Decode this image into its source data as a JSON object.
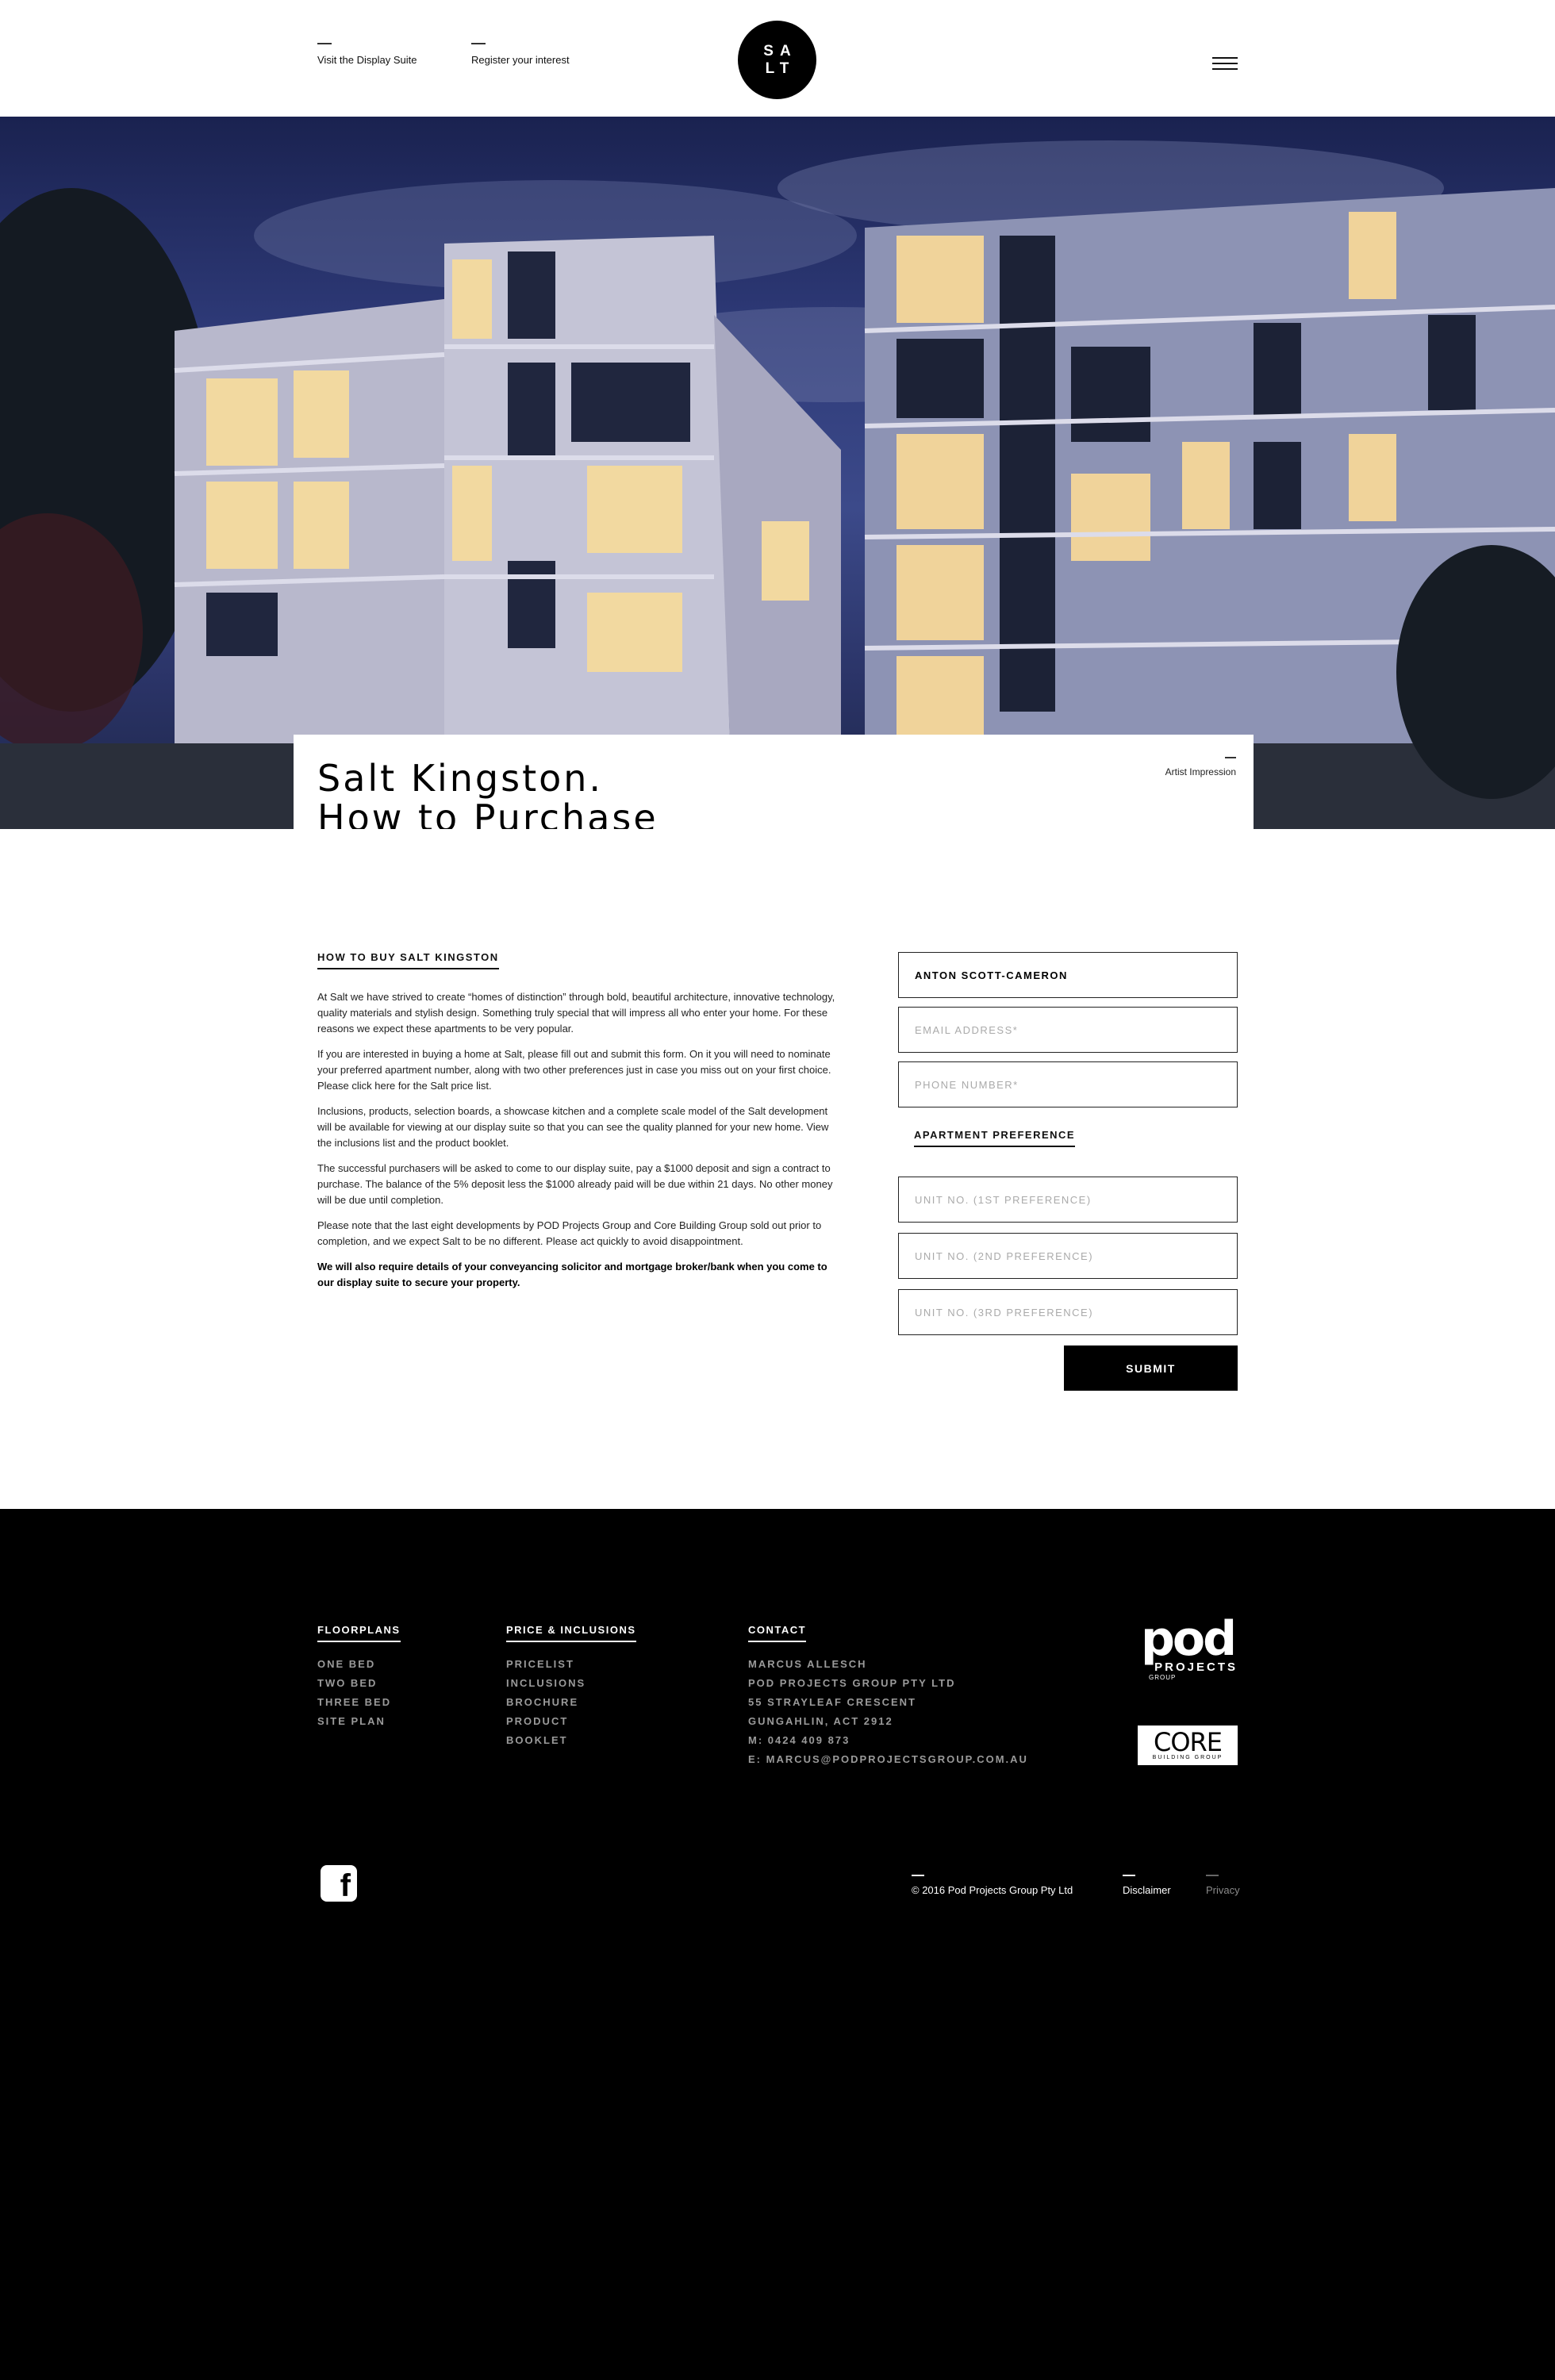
{
  "header": {
    "link_display": "Visit the Display Suite",
    "link_register": "Register your  interest",
    "logo_line1": "SA",
    "logo_line2": "LT",
    "menu_icon": "hamburger-icon"
  },
  "hero": {
    "title_line1": "Salt Kingston.",
    "title_line2": "How to Purchase",
    "caption": "Artist Impression"
  },
  "main": {
    "heading": "HOW TO BUY SALT KINGSTON",
    "paragraphs": [
      "At Salt we have strived to create “homes of distinction” through bold, beautiful architecture, innovative technology, quality materials and stylish design. Something truly special that will impress all who enter your home. For these reasons we expect these apartments to be very popular.",
      "If you are interested in buying a home at Salt, please fill out and submit this form.  On it you will need to nominate your preferred apartment number, along with two other preferences just in case you miss out on your first choice. Please click here for the Salt price list.",
      "Inclusions, products, selection boards, a showcase kitchen and a complete scale model of the Salt development will be available for viewing at our display suite so that you can see the quality planned for your new home. View the inclusions list and the product booklet.",
      "The successful purchasers will be asked to come to our display suite, pay a $1000 deposit and sign a contract to purchase.  The balance of the 5% deposit less the $1000 already paid will be due within 21 days. No other money will be due until completion.",
      "Please note that the last eight developments by POD Projects Group and Core Building Group sold out prior to completion, and we expect Salt to be no different.  Please act quickly to avoid disappointment."
    ],
    "bold_note": "We will also require details of your conveyancing solicitor and mortgage broker/bank when you come to our display suite to secure your property."
  },
  "form": {
    "name_value": "ANTON SCOTT-CAMERON",
    "email_placeholder": "EMAIL ADDRESS*",
    "phone_placeholder": "PHONE NUMBER*",
    "pref_heading": "APARTMENT PREFERENCE",
    "unit1_placeholder": "UNIT NO. (1ST PREFERENCE)",
    "unit2_placeholder": "UNIT NO. (2ND PREFERENCE)",
    "unit3_placeholder": "UNIT NO. (3RD PREFERENCE)",
    "submit_label": "SUBMIT"
  },
  "footer": {
    "floorplans": {
      "heading": "FLOORPLANS",
      "items": [
        "ONE BED",
        "TWO BED",
        "THREE BED",
        "SITE PLAN"
      ]
    },
    "price": {
      "heading": "PRICE & INCLUSIONS",
      "items": [
        "PRICELIST",
        "INCLUSIONS",
        "BROCHURE",
        "PRODUCT",
        "BOOKLET"
      ]
    },
    "contact": {
      "heading": "CONTACT",
      "items": [
        "MARCUS ALLESCH",
        "POD PROJECTS GROUP PTY LTD",
        "55 STRAYLEAF CRESCENT",
        "GUNGAHLIN, ACT 2912",
        "M: 0424 409 873",
        "E: MARCUS@PODPROJECTSGROUP.COM.AU"
      ]
    },
    "pod_logo_main": "pod",
    "pod_logo_sub": "PROJECTS",
    "pod_logo_group": "GROUP",
    "core_logo_main": "CORE",
    "core_logo_sub": "BUILDING GROUP",
    "facebook_icon": "facebook-icon",
    "facebook_glyph": "f",
    "copyright": "© 2016 Pod Projects Group Pty Ltd",
    "disclaimer": "Disclaimer",
    "privacy": "Privacy"
  },
  "colors": {
    "accent": "#000000",
    "background": "#ffffff",
    "footer_muted": "#9a9a9a"
  }
}
